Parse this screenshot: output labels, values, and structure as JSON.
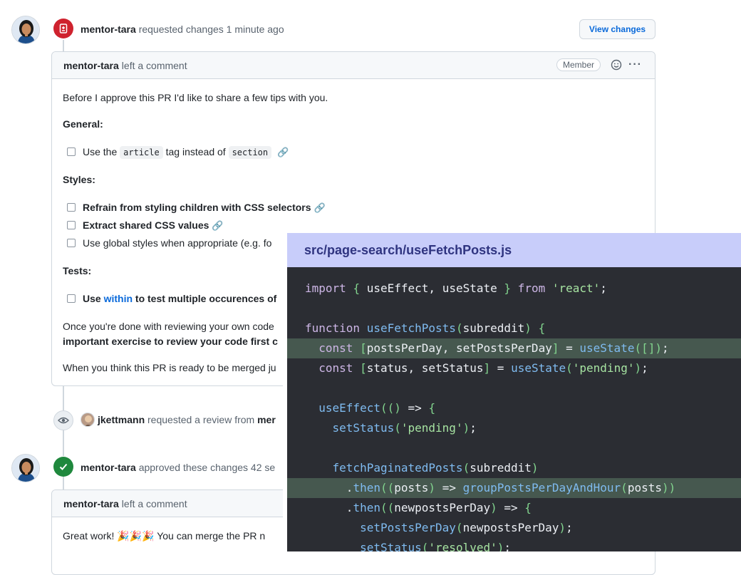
{
  "events": {
    "review1": {
      "author": "mentor-tara",
      "action": "requested changes",
      "time": "1 minute ago",
      "view_button": "View changes"
    },
    "comment1": {
      "author": "mentor-tara",
      "action": "left a comment",
      "badge": "Member",
      "intro": "Before I approve this PR I'd like to share a few tips with you.",
      "general_heading": "General:",
      "general_pre": "Use the",
      "general_code1": "article",
      "general_mid": "tag instead of",
      "general_code2": "section",
      "styles_heading": "Styles:",
      "styles_item1": "Refrain from styling children with CSS selectors",
      "styles_item2": "Extract shared CSS values",
      "styles_item3": "Use global styles when appropriate (e.g. fo",
      "tests_heading": "Tests:",
      "tests_pre": "Use",
      "tests_link": "within",
      "tests_post": "to test multiple occurences of",
      "outro_line1": "Once you're done with reviewing your own code",
      "outro_line2": "important exercise to review your code first c",
      "outro_line3": "When you think this PR is ready to be merged ju"
    },
    "review_request": {
      "author": "jkettmann",
      "action": "requested a review from",
      "target": "mer"
    },
    "approval": {
      "author": "mentor-tara",
      "action": "approved these changes",
      "time": "42 se"
    },
    "comment2": {
      "author": "mentor-tara",
      "action": "left a comment",
      "body_pre": "Great work!",
      "emoji": "🎉🎉🎉",
      "body_post": "You can merge the PR n"
    }
  },
  "code": {
    "file": "src/page-search/useFetchPosts.js",
    "lines": [
      "import { useEffect, useState } from 'react';",
      "",
      "function useFetchPosts(subreddit) {",
      "  const [postsPerDay, setPostsPerDay] = useState([]);",
      "  const [status, setStatus] = useState('pending');",
      "",
      "  useEffect(() => {",
      "    setStatus('pending');",
      "",
      "    fetchPaginatedPosts(subreddit)",
      "      .then((posts) => groupPostsPerDayAndHour(posts))",
      "      .then((newpostsPerDay) => {",
      "        setPostsPerDay(newpostsPerDay);",
      "        setStatus('resolved');"
    ],
    "highlighted_lines": [
      4,
      11
    ]
  },
  "colors": {
    "accent": "#0969da",
    "changes_requested": "#cf222e",
    "approved": "#1a7f37",
    "code_bg": "#2b2d33",
    "code_header": "#c8cdfa",
    "code_highlight": "#46584f"
  }
}
